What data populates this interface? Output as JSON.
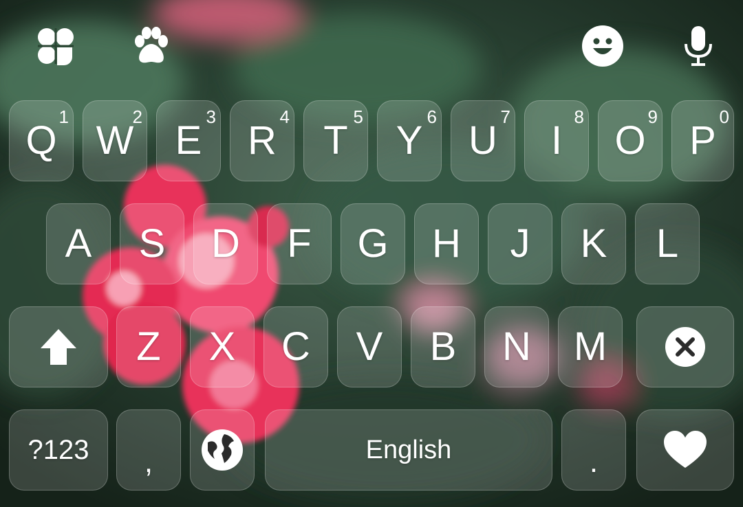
{
  "toolbar": {
    "left_icons": [
      "clover-icon",
      "paw-icon"
    ],
    "right_icons": [
      "emoji-icon",
      "microphone-icon"
    ]
  },
  "keyboard": {
    "row1": [
      {
        "label": "Q",
        "hint": "1"
      },
      {
        "label": "W",
        "hint": "2"
      },
      {
        "label": "E",
        "hint": "3"
      },
      {
        "label": "R",
        "hint": "4"
      },
      {
        "label": "T",
        "hint": "5"
      },
      {
        "label": "Y",
        "hint": "6"
      },
      {
        "label": "U",
        "hint": "7"
      },
      {
        "label": "I",
        "hint": "8"
      },
      {
        "label": "O",
        "hint": "9"
      },
      {
        "label": "P",
        "hint": "0"
      }
    ],
    "row2": [
      "A",
      "S",
      "D",
      "F",
      "G",
      "H",
      "J",
      "K",
      "L"
    ],
    "row3": [
      "Z",
      "X",
      "C",
      "V",
      "B",
      "N",
      "M"
    ],
    "row4": {
      "symbols": "?123",
      "comma": ",",
      "space": "English",
      "period": "."
    },
    "special_icons": [
      "shift-icon",
      "backspace-icon",
      "globe-icon",
      "heart-icon"
    ]
  },
  "colors": {
    "background_dark": "#1f3327",
    "rose": "#e8335a",
    "key_fill": "rgba(255,255,255,0.16)"
  }
}
